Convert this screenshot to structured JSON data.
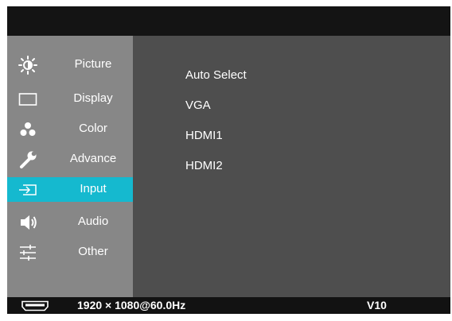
{
  "sidebar": {
    "items": [
      {
        "label": "Picture",
        "icon": "brightness-icon"
      },
      {
        "label": "Display",
        "icon": "display-icon"
      },
      {
        "label": "Color",
        "icon": "color-dots-icon"
      },
      {
        "label": "Advance",
        "icon": "wrench-icon"
      },
      {
        "label": "Input",
        "icon": "input-icon",
        "active": true
      },
      {
        "label": "Audio",
        "icon": "speaker-icon"
      },
      {
        "label": "Other",
        "icon": "sliders-icon"
      }
    ]
  },
  "options": [
    "Auto Select",
    "VGA",
    "HDMI1",
    "HDMI2"
  ],
  "status": {
    "connector_icon": "hdmi-connector-icon",
    "resolution": "1920 × 1080@60.0Hz",
    "version": "V10"
  },
  "colors": {
    "accent": "#15b9cf",
    "sidebar": "#878787",
    "content": "#4e4e4e",
    "frame": "#121212"
  }
}
